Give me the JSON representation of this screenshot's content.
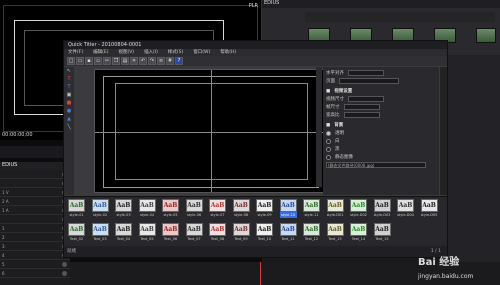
{
  "app": {
    "edius_label": "EDIUS",
    "plr_label": "PLR",
    "timecode": "00:00:00;00",
    "bin_header": "EDIUS",
    "track_labels": [
      "",
      "",
      "1 V",
      "2 A",
      "1 A",
      "",
      "1",
      "2",
      "3",
      "4",
      "5",
      "6"
    ]
  },
  "titler": {
    "title": "Quick Titler - 20100804-0001",
    "menu": [
      "文件(F)",
      "编辑(E)",
      "视图(V)",
      "插入(I)",
      "样式(S)",
      "窗口(W)",
      "帮助(H)"
    ],
    "toolbar_icons": [
      "new-icon",
      "open-icon",
      "save-icon",
      "saveas-icon",
      "cut-icon",
      "copy-icon",
      "paste-icon",
      "delete-icon",
      "undo-icon",
      "redo-icon",
      "align-icon",
      "grid-icon",
      "help-icon"
    ],
    "help_label": "?",
    "tools": [
      "select-icon",
      "text-icon",
      "vtext-icon",
      "image-icon",
      "rect-icon",
      "ellipse-icon",
      "triangle-icon",
      "line-icon"
    ],
    "props": {
      "header": "水平对齐",
      "field1": "页面",
      "section_video": "视频设置",
      "size_label": "视频尺寸",
      "aspect_label": "帧尺寸",
      "ratio_label": "宽高比",
      "section_bg": "背景",
      "bg_options": [
        "透明",
        "白",
        "黑",
        "静态图像"
      ],
      "image_path": "(静态文件路径(0000.jpg)"
    },
    "styles_row1": [
      "style-01",
      "style-02",
      "style-03",
      "style-04",
      "style-05",
      "style-06",
      "style-07",
      "style-08",
      "style-09",
      "style-10",
      "style-11",
      "style-D01",
      "style-D02",
      "style-D03",
      "style-D04",
      "style-D05"
    ],
    "styles_row2": [
      "Text_02",
      "Text_03",
      "Text_04",
      "Text_05",
      "Text_06",
      "Text_07",
      "Text_08",
      "Text_09",
      "Text_10",
      "Text_11",
      "Text_12",
      "Text_13",
      "Text_14",
      "Text_15"
    ],
    "style_glyph": "AaB",
    "status": "就绪",
    "page": "1 / 1"
  },
  "watermark": {
    "text": "Bai 经验",
    "url": "jingyan.baidu.com"
  },
  "colors": {
    "accent": "#3a6ae0",
    "window_bg": "#3a3a3f",
    "canvas": "#000000"
  }
}
